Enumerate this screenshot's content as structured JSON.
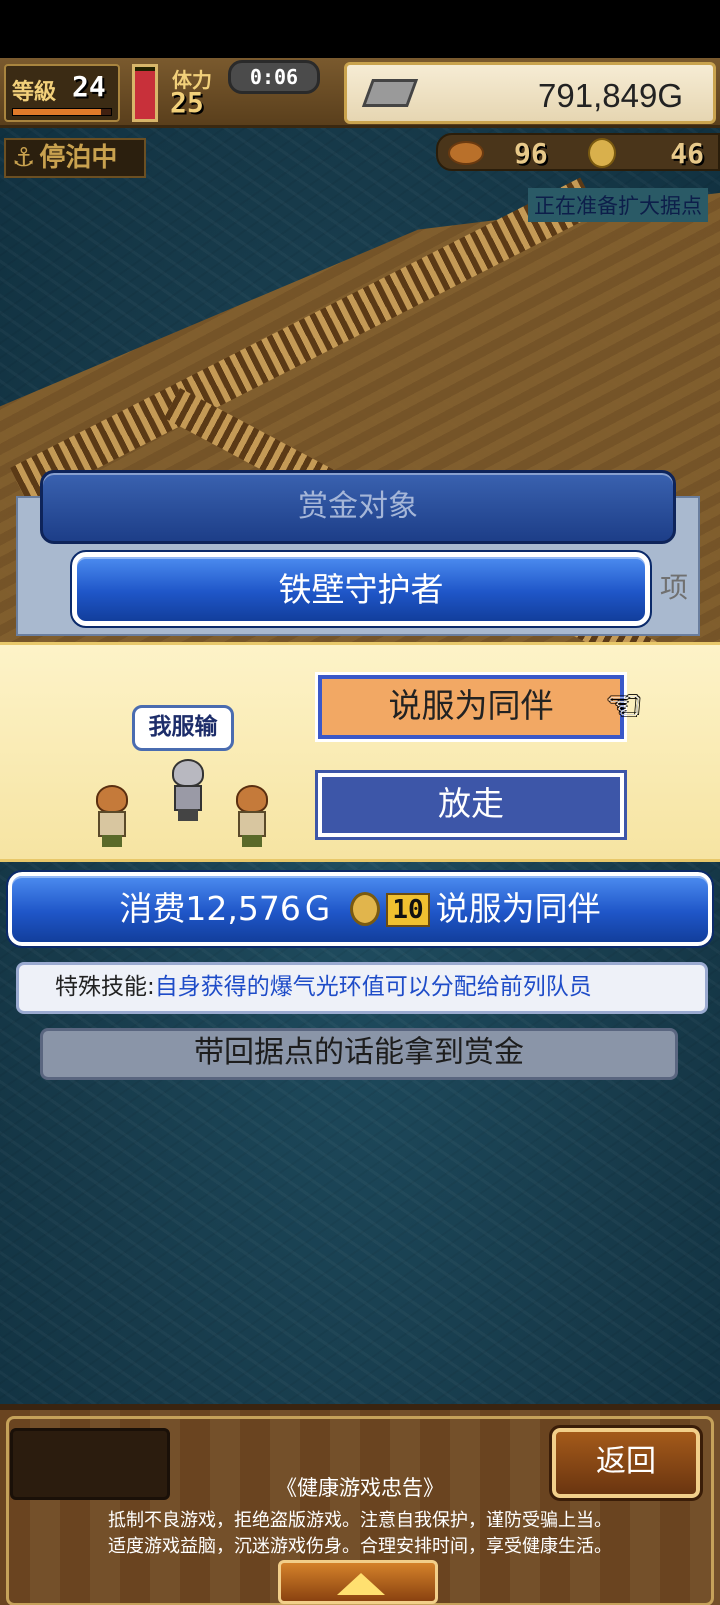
{
  "hud": {
    "level_label": "等級",
    "level_value": "24",
    "level_progress": 0.9,
    "stamina_label": "体力",
    "stamina_value": "25",
    "stamina_fill": 0.92,
    "timer": "0:06",
    "gold": "791,849G"
  },
  "status": {
    "anchor": "停泊中",
    "food": "96",
    "medals": "46",
    "message": "正在准备扩大据点"
  },
  "bounty": {
    "header": "赏金对象",
    "target_name": "铁壁守护者",
    "partial_text": "项"
  },
  "dialog": {
    "speech": "我服输",
    "recruit_label": "说服为同伴",
    "release_label": "放走"
  },
  "recruit_cost": {
    "prefix": "消费12,576Ｇ",
    "medal_cost": "10",
    "suffix": "说服为同伴"
  },
  "skill": {
    "label": "特殊技能:",
    "description": "自身获得的爆气光环值可以分配给前列队员"
  },
  "bounty_note": "带回据点的话能拿到赏金",
  "bottom": {
    "back_label": "返回",
    "health_title": "《健康游戏忠告》",
    "health_line_1": "抵制不良游戏，拒绝盗版游戏。注意自我保护，谨防受骗上当。",
    "health_line_2": "适度游戏益脑，沉迷游戏伤身。合理安排时间，享受健康生活。"
  },
  "colors": {
    "accent_blue": "#1f56c8",
    "dialog_yellow": "#fdf3c8",
    "recruit_orange": "#f2a864",
    "skill_blue": "#1e4cc8"
  }
}
